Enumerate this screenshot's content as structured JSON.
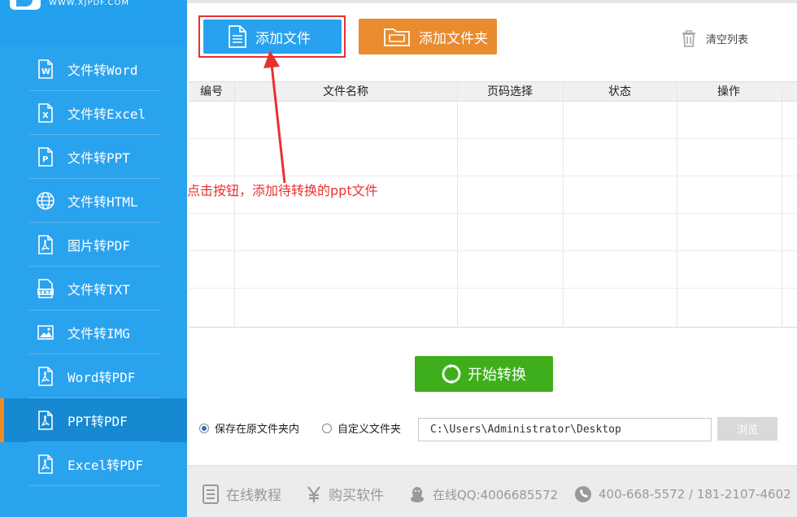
{
  "logo": {
    "site": "WWW.XJPDF.COM"
  },
  "sidebar": {
    "items": [
      {
        "label": "文件转Word",
        "icon": "word-doc-icon"
      },
      {
        "label": "文件转Excel",
        "icon": "excel-doc-icon"
      },
      {
        "label": "文件转PPT",
        "icon": "ppt-doc-icon"
      },
      {
        "label": "文件转HTML",
        "icon": "globe-icon"
      },
      {
        "label": "图片转PDF",
        "icon": "pdf-doc-icon"
      },
      {
        "label": "文件转TXT",
        "icon": "txt-doc-icon"
      },
      {
        "label": "文件转IMG",
        "icon": "image-icon"
      },
      {
        "label": "Word转PDF",
        "icon": "pdf-doc-icon"
      },
      {
        "label": "PPT转PDF",
        "icon": "pdf-doc-icon",
        "active": true
      },
      {
        "label": "Excel转PDF",
        "icon": "pdf-doc-icon"
      }
    ]
  },
  "toolbar": {
    "add_file": "添加文件",
    "add_folder": "添加文件夹",
    "clear_list": "清空列表"
  },
  "table": {
    "headers": [
      "编号",
      "文件名称",
      "页码选择",
      "状态",
      "操作"
    ],
    "rows": []
  },
  "annotation": "点击按钮，添加待转换的ppt文件",
  "start_button": "开始转换",
  "save": {
    "option_original": "保存在原文件夹内",
    "option_custom": "自定义文件夹",
    "selected": "option_original",
    "path": "C:\\Users\\Administrator\\Desktop",
    "browse": "浏览"
  },
  "footer": {
    "tutorial": "在线教程",
    "buy": "购买软件",
    "qq": "在线QQ:4006685572",
    "phone": "400-668-5572 / 181-2107-4602"
  },
  "colors": {
    "sidebar": "#2aa3ef",
    "sidebar_active": "#1789d3",
    "accent_orange": "#e98b2f",
    "add_file_blue": "#28a2ee",
    "start_green": "#3fae1c",
    "annotation_red": "#e8312f"
  }
}
